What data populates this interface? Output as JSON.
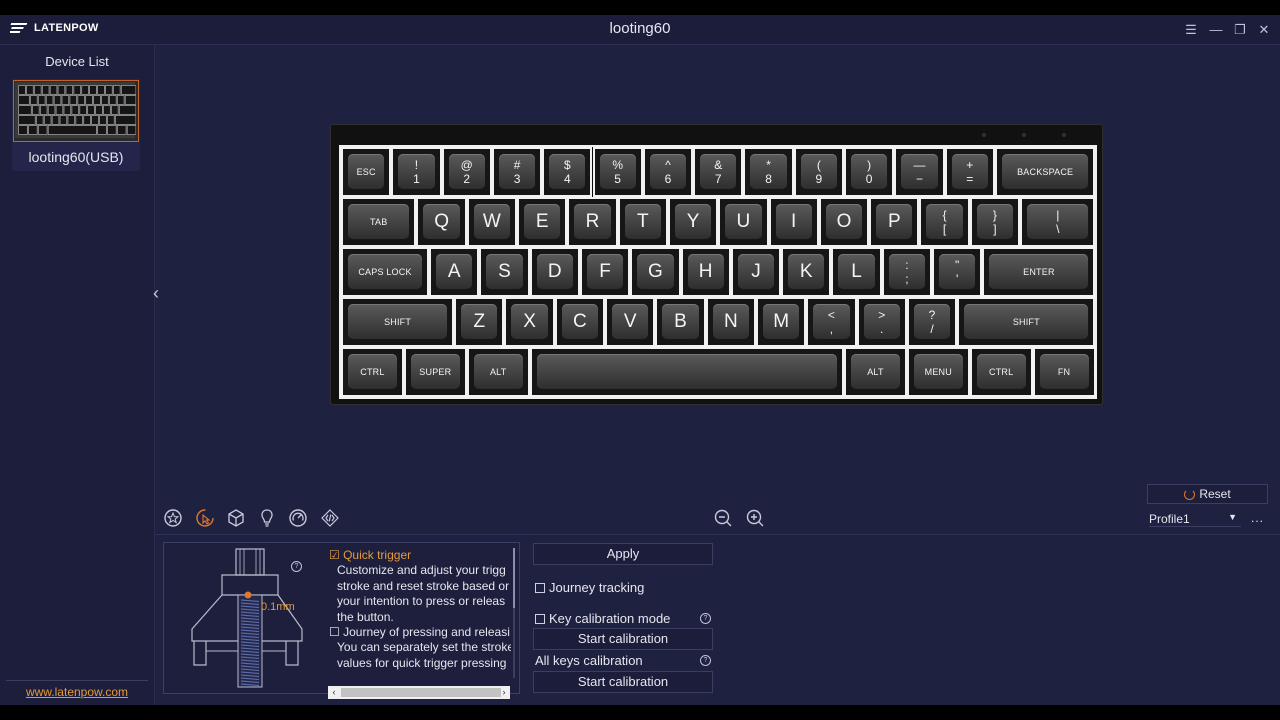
{
  "app": {
    "brand": "LATENPOW",
    "title": "looting60",
    "website": "www.latenpow.com"
  },
  "sidebar": {
    "header": "Device List",
    "devices": [
      {
        "name": "looting60(USB)",
        "selected": true
      }
    ]
  },
  "keyboard": {
    "rows": [
      [
        {
          "t": "ESC",
          "s": "small"
        },
        {
          "u": "!",
          "l": "1"
        },
        {
          "u": "@",
          "l": "2"
        },
        {
          "u": "#",
          "l": "3"
        },
        {
          "u": "$",
          "l": "4"
        },
        {
          "u": "%",
          "l": "5"
        },
        {
          "u": "^",
          "l": "6"
        },
        {
          "u": "&",
          "l": "7"
        },
        {
          "u": "*",
          "l": "8"
        },
        {
          "u": "(",
          "l": "9"
        },
        {
          "u": ")",
          "l": "0"
        },
        {
          "u": "—",
          "l": "−"
        },
        {
          "u": "+",
          "l": "="
        },
        {
          "t": "BACKSPACE",
          "s": "small"
        }
      ],
      [
        {
          "t": "TAB",
          "s": "small"
        },
        {
          "t": "Q"
        },
        {
          "t": "W"
        },
        {
          "t": "E"
        },
        {
          "t": "R"
        },
        {
          "t": "T"
        },
        {
          "t": "Y"
        },
        {
          "t": "U"
        },
        {
          "t": "I"
        },
        {
          "t": "O"
        },
        {
          "t": "P"
        },
        {
          "u": "{",
          "l": "["
        },
        {
          "u": "}",
          "l": "]"
        },
        {
          "u": "|",
          "l": "\\"
        }
      ],
      [
        {
          "t": "CAPS LOCK",
          "s": "small"
        },
        {
          "t": "A"
        },
        {
          "t": "S"
        },
        {
          "t": "D"
        },
        {
          "t": "F"
        },
        {
          "t": "G"
        },
        {
          "t": "H"
        },
        {
          "t": "J"
        },
        {
          "t": "K"
        },
        {
          "t": "L"
        },
        {
          "u": ":",
          "l": ";"
        },
        {
          "u": "\"",
          "l": "'"
        },
        {
          "t": "ENTER",
          "s": "small"
        }
      ],
      [
        {
          "t": "SHIFT",
          "s": "small"
        },
        {
          "t": "Z"
        },
        {
          "t": "X"
        },
        {
          "t": "C"
        },
        {
          "t": "V"
        },
        {
          "t": "B"
        },
        {
          "t": "N"
        },
        {
          "t": "M"
        },
        {
          "u": "<",
          "l": ","
        },
        {
          "u": ">",
          "l": "."
        },
        {
          "u": "?",
          "l": "/"
        },
        {
          "t": "SHIFT",
          "s": "small"
        }
      ],
      [
        {
          "t": "CTRL",
          "s": "small"
        },
        {
          "t": "SUPER",
          "s": "small"
        },
        {
          "t": "ALT",
          "s": "small"
        },
        {
          "t": "",
          "s": "small"
        },
        {
          "t": "ALT",
          "s": "small"
        },
        {
          "t": "MENU",
          "s": "small"
        },
        {
          "t": "CTRL",
          "s": "small"
        },
        {
          "t": "FN",
          "s": "small"
        }
      ]
    ]
  },
  "toolbar": {
    "icons": [
      "star-icon",
      "quick-trigger-icon",
      "cube-icon",
      "lightbulb-icon",
      "gauge-icon",
      "code-icon"
    ],
    "active_index": 1,
    "zoom": [
      "zoom-out-icon",
      "zoom-in-icon"
    ]
  },
  "right_controls": {
    "reset_label": "Reset",
    "profile_value": "Profile1",
    "more": "..."
  },
  "switch_panel": {
    "travel": "0.1mm",
    "help": "?",
    "quick_trigger_label": "Quick trigger",
    "quick_trigger_checked": true,
    "quick_trigger_desc": [
      "Customize and adjust your trigg",
      "stroke and reset stroke based or",
      "your intention to press or releas",
      "the button."
    ],
    "journey_label": "Journey of pressing and releasi",
    "journey_checked": false,
    "journey_desc": [
      "You can separately set the stroke",
      "values for quick trigger pressing"
    ]
  },
  "actions": {
    "apply": "Apply",
    "journey_tracking": "Journey tracking",
    "key_calibration_mode": "Key calibration mode",
    "start_calibration_1": "Start calibration",
    "all_keys_calibration": "All keys calibration",
    "start_calibration_2": "Start calibration",
    "help": "?"
  },
  "colors": {
    "background": "#1f2140",
    "accent": "#e0772f",
    "link": "#e39a3a"
  }
}
